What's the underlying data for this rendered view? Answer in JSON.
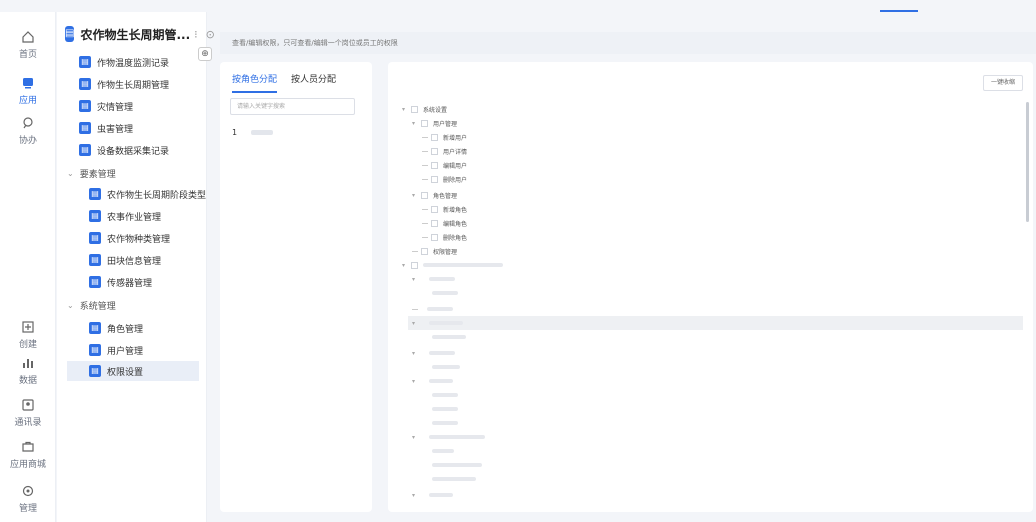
{
  "rail": [
    {
      "icon": "home-icon",
      "label": "首页",
      "active": false
    },
    {
      "icon": "apps-icon",
      "label": "应用",
      "active": true
    },
    {
      "icon": "collab-icon",
      "label": "协办",
      "active": false
    },
    {
      "icon": "create-icon",
      "label": "创建",
      "active": false
    },
    {
      "icon": "data-icon",
      "label": "数据",
      "active": false
    },
    {
      "icon": "contacts-icon",
      "label": "通讯录",
      "active": false
    },
    {
      "icon": "store-icon",
      "label": "应用商城",
      "active": false
    },
    {
      "icon": "settings-icon",
      "label": "管理",
      "active": false
    }
  ],
  "app": {
    "title": "农作物生长周期管...",
    "more": "⁝",
    "pin": "⊙",
    "collapse": "⊕"
  },
  "nav": {
    "items_top": [
      "作物温度监测记录",
      "作物生长周期管理",
      "灾情管理",
      "虫害管理",
      "设备数据采集记录"
    ],
    "group1": "要素管理",
    "group1_items": [
      "农作物生长周期阶段类型",
      "农事作业管理",
      "农作物种类管理",
      "田块信息管理",
      "传感器管理"
    ],
    "group2": "系统管理",
    "group2_items": [
      "角色管理",
      "用户管理",
      "权限设置"
    ]
  },
  "hint": "查看/编辑权限，只可查看/编辑一个岗位或员工的权限",
  "tabs": [
    "按角色分配",
    "按人员分配"
  ],
  "search": {
    "placeholder": "请输入关键字搜索"
  },
  "roles": [
    {
      "index": "1"
    }
  ],
  "collapse_all": "一键收缩",
  "tree": {
    "root": "系统设置",
    "user_mgmt": "用户管理",
    "user_children": [
      "新增用户",
      "用户详情",
      "编辑用户",
      "删除用户"
    ],
    "role_mgmt": "角色管理",
    "role_children": [
      "新增角色",
      "编辑角色",
      "删除角色"
    ],
    "perm_mgmt": "权限管理"
  },
  "colors": {
    "accent": "#2f6fe4"
  }
}
